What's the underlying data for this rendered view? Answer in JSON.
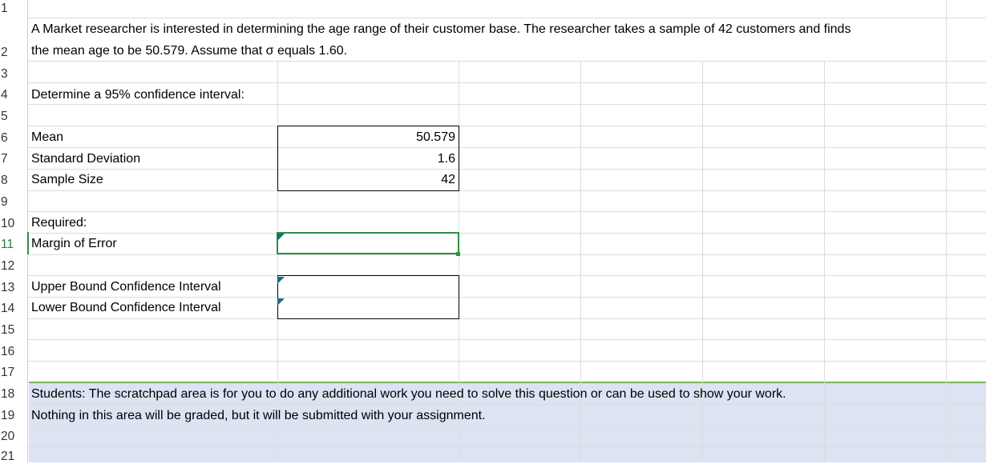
{
  "row_numbers": [
    "1",
    "2",
    "3",
    "4",
    "5",
    "6",
    "7",
    "8",
    "9",
    "10",
    "11",
    "12",
    "13",
    "14",
    "15",
    "16",
    "17",
    "18",
    "19",
    "20",
    "21"
  ],
  "active_row": "11",
  "cells": {
    "question_line1": "A Market researcher is interested in determining the age range of their customer base. The researcher takes a sample of 42 customers and finds",
    "question_line2": "the mean age to be 50.579. Assume that σ equals 1.60.",
    "instruction": "Determine a 95% confidence interval:",
    "mean_label": "Mean",
    "mean_value": "50.579",
    "sd_label": "Standard Deviation",
    "sd_value": "1.6",
    "n_label": "Sample Size",
    "n_value": "42",
    "required_label": "Required:",
    "moe_label": "Margin of Error",
    "moe_value": "",
    "upper_label": "Upper Bound Confidence Interval",
    "upper_value": "",
    "lower_label": "Lower Bound Confidence Interval",
    "lower_value": "",
    "scratch_line1": "Students: The scratchpad area is for you to do any additional work you need to solve this question or can be used to show your work.",
    "scratch_line2": "Nothing in this area will be graded, but it will be submitted with your assignment."
  },
  "colors": {
    "gridline": "#dcdcdc",
    "scratchpad_fill": "#dce3f3",
    "selection_green": "#2f8f46",
    "comment_marker": "#1a6f70"
  }
}
